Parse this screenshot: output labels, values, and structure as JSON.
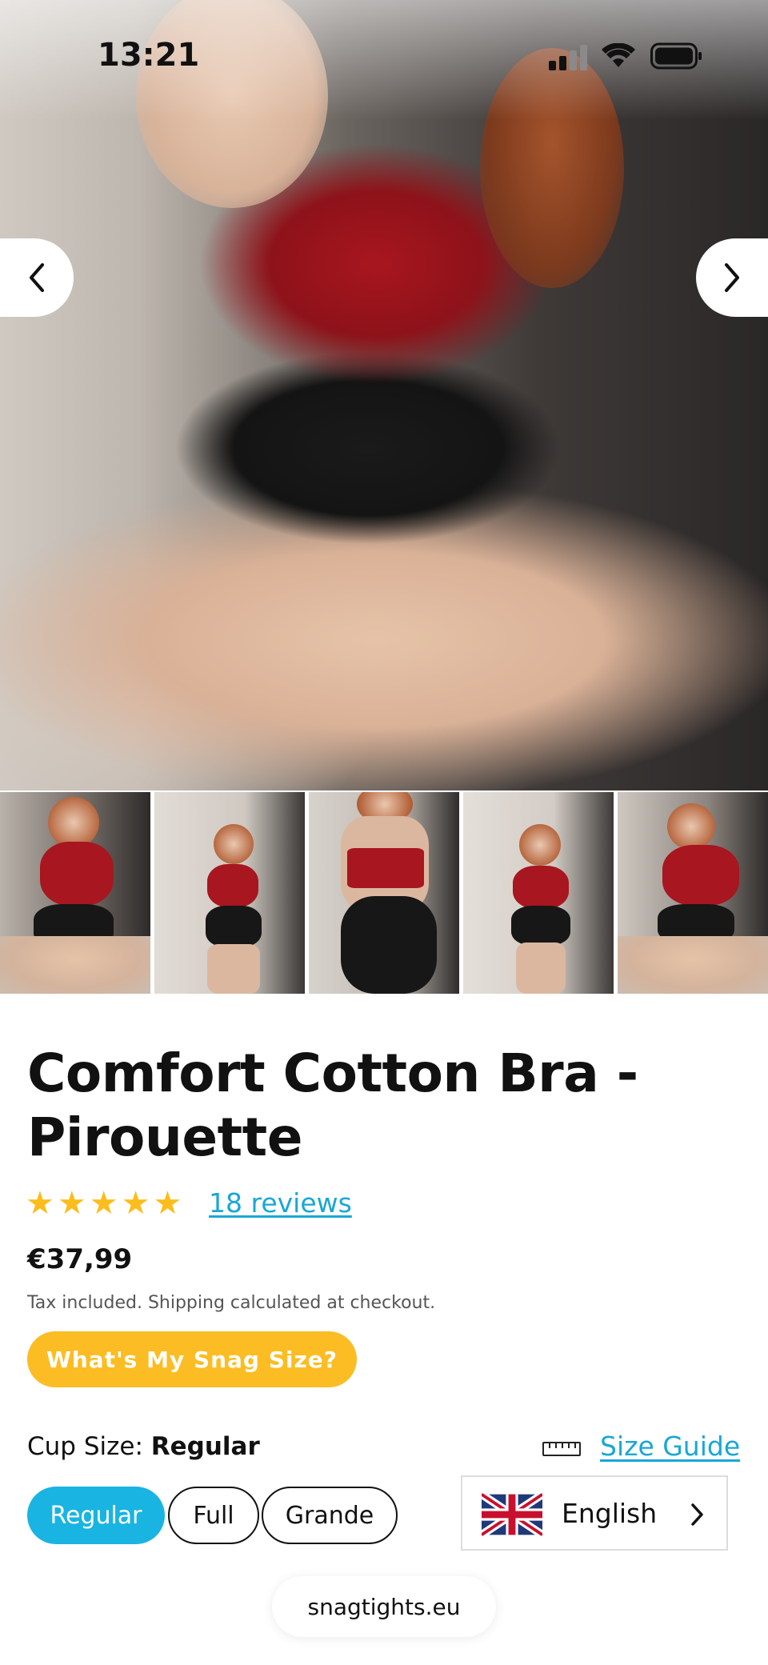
{
  "status_bar": {
    "time": "13:21"
  },
  "product": {
    "title_line1": "Comfort Cotton Bra -",
    "title_line2": "Pirouette",
    "reviews_link": "18 reviews",
    "rating_stars": 5,
    "price": "€37,99",
    "tax_note": "Tax included. Shipping calculated at checkout.",
    "snag_size_button": "What's My Snag Size?"
  },
  "cup_size": {
    "label": "Cup Size:",
    "selected": "Regular",
    "size_guide": "Size Guide",
    "options": [
      "Regular",
      "Full",
      "Grande"
    ]
  },
  "language": {
    "current": "English"
  },
  "browser": {
    "url": "snagtights.eu"
  },
  "colors": {
    "accent_blue": "#19b4e2",
    "star_yellow": "#fbbd1c",
    "button_yellow": "#fbbd23"
  }
}
